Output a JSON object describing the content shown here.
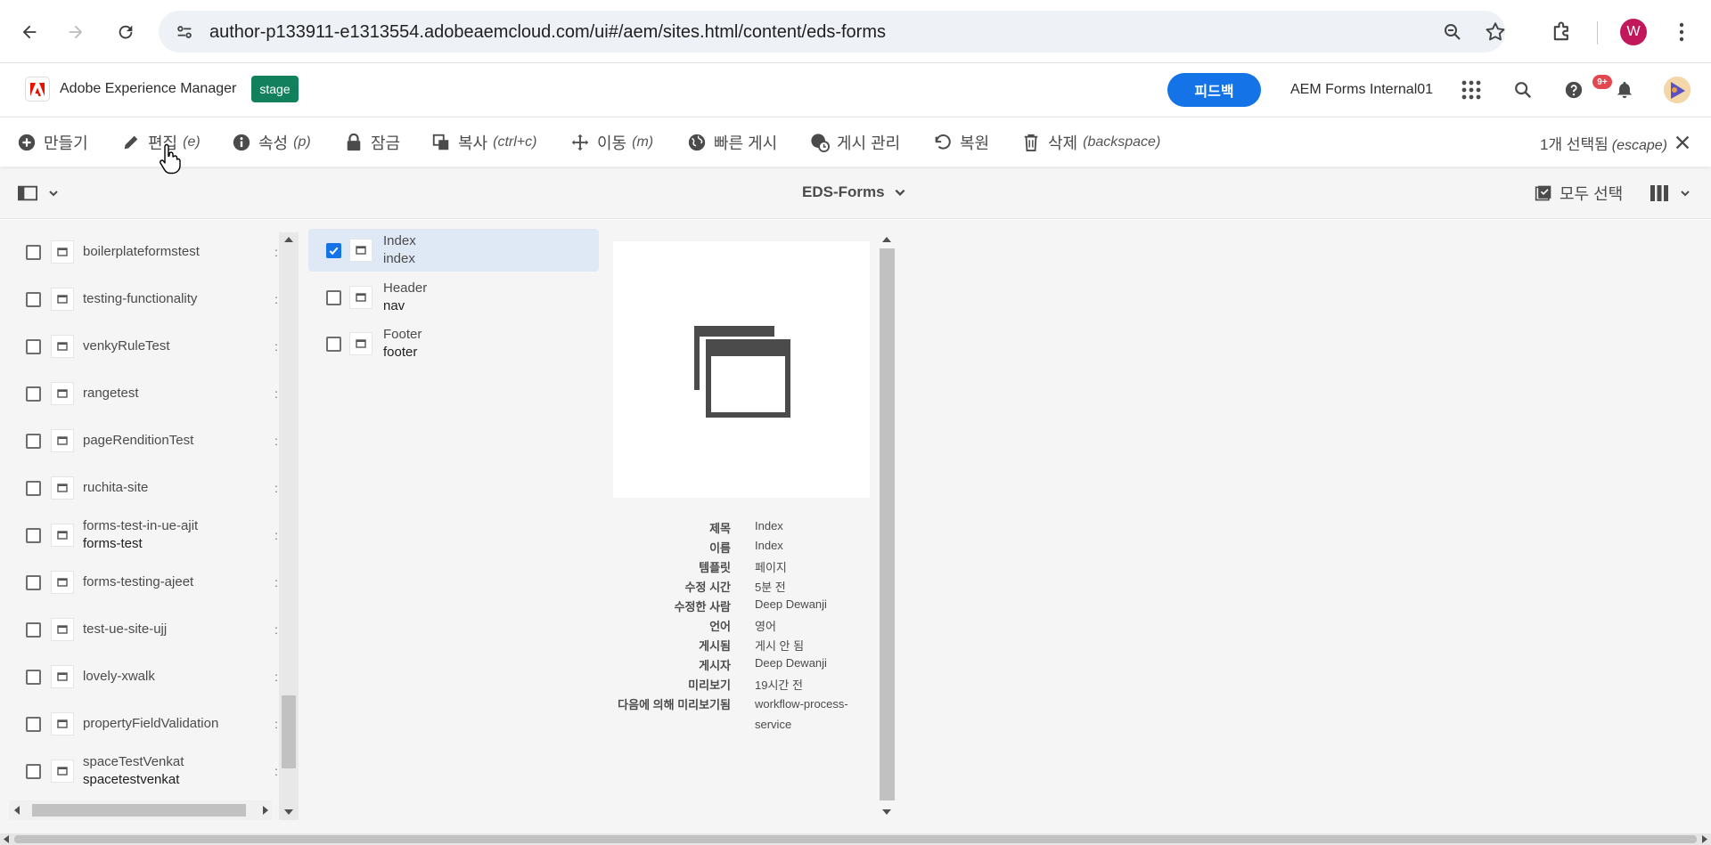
{
  "browser": {
    "url": "author-p133911-e1313554.adobeaemcloud.com/ui#/aem/sites.html/content/eds-forms",
    "profile_initial": "W"
  },
  "header": {
    "brand": "Adobe Experience Manager",
    "env_badge": "stage",
    "feedback_label": "피드백",
    "org_name": "AEM Forms Internal01",
    "notification_count": "9+"
  },
  "actions": [
    {
      "label": "만들기",
      "shortcut": "",
      "icon": "plus-circle-icon"
    },
    {
      "label": "편집",
      "shortcut": "(e)",
      "icon": "pencil-icon"
    },
    {
      "label": "속성",
      "shortcut": "(p)",
      "icon": "info-icon"
    },
    {
      "label": "잠금",
      "shortcut": "",
      "icon": "lock-icon"
    },
    {
      "label": "복사",
      "shortcut": "(ctrl+c)",
      "icon": "copy-icon"
    },
    {
      "label": "이동",
      "shortcut": "(m)",
      "icon": "move-icon"
    },
    {
      "label": "빠른 게시",
      "shortcut": "",
      "icon": "globe-icon"
    },
    {
      "label": "게시 관리",
      "shortcut": "",
      "icon": "globe-clock-icon"
    },
    {
      "label": "복원",
      "shortcut": "",
      "icon": "undo-icon"
    },
    {
      "label": "삭제",
      "shortcut": "(backspace)",
      "icon": "trash-icon"
    }
  ],
  "selection": {
    "label": "1개 선택됨",
    "shortcut": "(escape)"
  },
  "subheader": {
    "breadcrumb": "EDS-Forms",
    "select_all": "모두 선택"
  },
  "column1": [
    {
      "title": "boilerplateformstest",
      "name": ""
    },
    {
      "title": "testing-functionality",
      "name": ""
    },
    {
      "title": "venkyRuleTest",
      "name": ""
    },
    {
      "title": "rangetest",
      "name": ""
    },
    {
      "title": "pageRenditionTest",
      "name": ""
    },
    {
      "title": "ruchita-site",
      "name": ""
    },
    {
      "title": "forms-test-in-ue-ajit",
      "name": "forms-test"
    },
    {
      "title": "forms-testing-ajeet",
      "name": ""
    },
    {
      "title": "test-ue-site-ujj",
      "name": ""
    },
    {
      "title": "lovely-xwalk",
      "name": ""
    },
    {
      "title": "propertyFieldValidation",
      "name": ""
    },
    {
      "title": "spaceTestVenkat",
      "name": "spacetestvenkat"
    }
  ],
  "column2": [
    {
      "title": "Index",
      "name": "index",
      "selected": true
    },
    {
      "title": "Header",
      "name": "nav",
      "selected": false
    },
    {
      "title": "Footer",
      "name": "footer",
      "selected": false
    }
  ],
  "details": [
    {
      "key": "제목",
      "value": "Index"
    },
    {
      "key": "이름",
      "value": "Index"
    },
    {
      "key": "템플릿",
      "value": "페이지"
    },
    {
      "key": "수정 시간",
      "value": "5분 전"
    },
    {
      "key": "수정한 사람",
      "value": "Deep Dewanji"
    },
    {
      "key": "언어",
      "value": "영어"
    },
    {
      "key": "게시됨",
      "value": "게시 안 됨"
    },
    {
      "key": "게시자",
      "value": "Deep Dewanji"
    },
    {
      "key": "미리보기",
      "value": "19시간 전"
    },
    {
      "key": "다음에 의해 미리보기됨",
      "value": "workflow-process-service"
    }
  ],
  "colors": {
    "accent": "#1473e6",
    "env_badge": "#12805c",
    "selected_row": "#dfe9f5",
    "notification": "#e34850",
    "profile": "#c2185b"
  }
}
